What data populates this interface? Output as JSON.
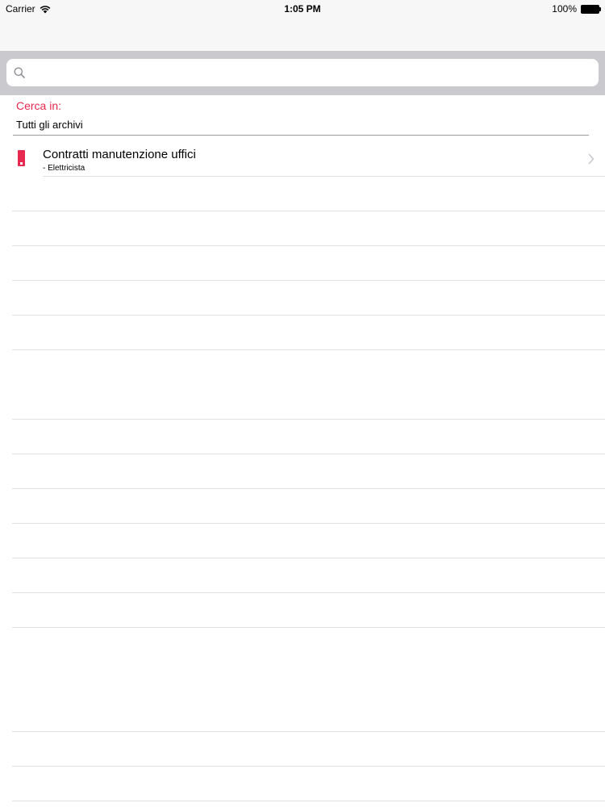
{
  "status_bar": {
    "carrier": "Carrier",
    "time": "1:05 PM",
    "battery": "100%",
    "wifi_icon": "wifi-icon",
    "battery_icon": "battery-icon"
  },
  "search": {
    "placeholder": "",
    "value": "",
    "icon": "search-icon"
  },
  "scope": {
    "label": "Cerca in:",
    "value": "Tutti gli archivi",
    "label_color": "#e8294f"
  },
  "results": [
    {
      "title": "Contratti manutenzione uffici",
      "subtitle": "- Elettricista",
      "marker_color": "#e8294f",
      "accessory_icon": "chevron-right-icon"
    }
  ]
}
